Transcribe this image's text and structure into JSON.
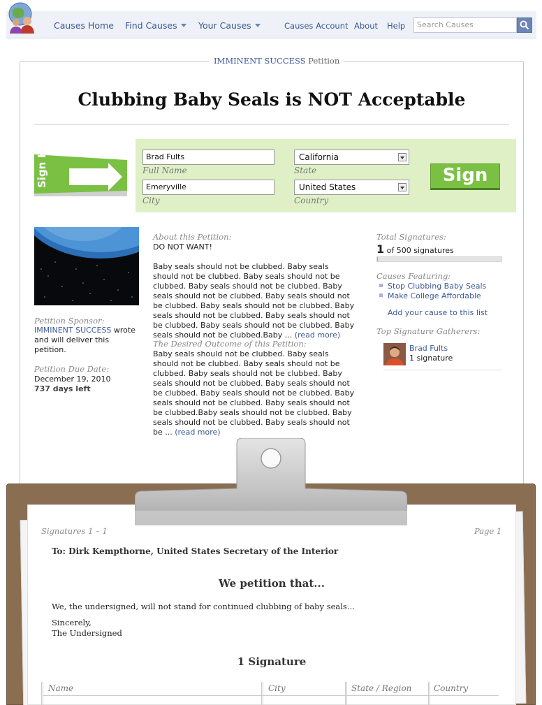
{
  "nav": {
    "items": [
      "Causes Home",
      "Find Causes",
      "Your Causes"
    ],
    "right_items": [
      "Causes Account",
      "About",
      "Help"
    ],
    "search_placeholder": "Search Causes"
  },
  "card": {
    "legend_by": "IMMINENT SUCCESS",
    "legend_type": "Petition",
    "title": "Clubbing Baby Seals is NOT Acceptable"
  },
  "sign_form": {
    "sign_here": "Sign Here",
    "full_name_value": "Brad Fults",
    "full_name_label": "Full Name",
    "city_value": "Emeryville",
    "city_label": "City",
    "state_value": "California",
    "state_label": "State",
    "country_value": "United States",
    "country_label": "Country",
    "sign_button": "Sign"
  },
  "sponsor": {
    "label": "Petition Sponsor:",
    "name": "IMMINENT SUCCESS",
    "text": " wrote and will deliver this petition.",
    "due_label": "Petition Due Date:",
    "due_date": "December 19, 2010",
    "days_left": "737 days left"
  },
  "about": {
    "label": "About this Petition:",
    "subtitle": "DO NOT WANT!",
    "text": "Baby seals should not be clubbed. Baby seals should not be clubbed. Baby seals should not be clubbed. Baby seals should not be clubbed. Baby seals should not be clubbed. Baby seals should not be clubbed. Baby seals should not be clubbed. Baby seals should not be clubbed. Baby seals should not be clubbed. Baby seals should not be clubbed. Baby seals should not be clubbed.Baby ... ",
    "read_more": "(read more)"
  },
  "outcome": {
    "label": "The Desired Outcome of this Petition:",
    "text": "Baby seals should not be clubbed. Baby seals should not be clubbed. Baby seals should not be clubbed. Baby seals should not be clubbed. Baby seals should not be clubbed. Baby seals should not be clubbed. Baby seals should not be clubbed. Baby seals should not be clubbed. Baby seals should not be clubbed.Baby seals should not be clubbed. Baby seals should not be clubbed. Baby seals should not be ... ",
    "read_more": "(read more)"
  },
  "stats": {
    "total_label": "Total Signatures:",
    "count": "1",
    "of_text": " of 500 signatures",
    "progress_fraction": 0.002,
    "featuring_label": "Causes Featuring:",
    "causes": [
      "Stop Clubbing Baby Seals",
      "Make College Affordable"
    ],
    "add_cause": "Add your cause to this list",
    "gatherers_label": "Top Signature Gatherers:",
    "gatherer_name": "Brad Fults",
    "gatherer_count": "1 signature"
  },
  "sheet": {
    "range": "Signatures 1 – 1",
    "page": "Page 1",
    "to": "To: Dirk Kempthorne, United States Secretary of the Interior",
    "we_petition": "We petition that...",
    "body": "We, the undersigned, will not stand for continued clubbing of baby seals...",
    "sincerely": "Sincerely,",
    "undersigned": "The Undersigned",
    "sig_count": "1 Signature",
    "columns": [
      "Name",
      "City",
      "State / Region",
      "Country"
    ]
  },
  "colors": {
    "link": "#3b5998",
    "sign_green": "#7ac143",
    "sign_box": "#dff0c6",
    "board": "#8a6e52"
  }
}
